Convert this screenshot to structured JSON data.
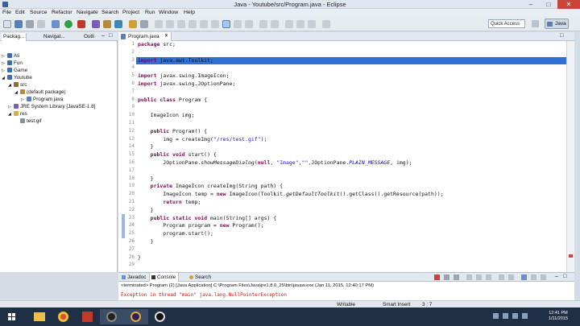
{
  "window": {
    "title": "Java - Youtube/src/Program.java - Eclipse"
  },
  "menu": [
    "File",
    "Edit",
    "Source",
    "Refactor",
    "Navigate",
    "Search",
    "Project",
    "Run",
    "Window",
    "Help"
  ],
  "toolbar": {
    "quick_access": "Quick Access",
    "perspective": "Java"
  },
  "left_panel": {
    "tabs": [
      "Packag...",
      "Navigat...",
      "Outli"
    ],
    "tree": [
      {
        "label": "Ali",
        "indent": 0,
        "arrow": "▷",
        "icon": "project"
      },
      {
        "label": "Fun",
        "indent": 0,
        "arrow": "▷",
        "icon": "project"
      },
      {
        "label": "Game",
        "indent": 0,
        "arrow": "▷",
        "icon": "project"
      },
      {
        "label": "Youtube",
        "indent": 0,
        "arrow": "◢",
        "icon": "project"
      },
      {
        "label": "src",
        "indent": 1,
        "arrow": "◢",
        "icon": "srcfolder"
      },
      {
        "label": "(default package)",
        "indent": 2,
        "arrow": "◢",
        "icon": "package"
      },
      {
        "label": "Program.java",
        "indent": 3,
        "arrow": "▷",
        "icon": "java"
      },
      {
        "label": "JRE System Library [JavaSE-1.8]",
        "indent": 1,
        "arrow": "▷",
        "icon": "library"
      },
      {
        "label": "res",
        "indent": 1,
        "arrow": "◢",
        "icon": "folder"
      },
      {
        "label": "test.gif",
        "indent": 2,
        "arrow": "",
        "icon": "file"
      }
    ]
  },
  "editor": {
    "tab": "Program.java",
    "lines": [
      {
        "n": "1",
        "html": "<span class='kw'>package</span> src;"
      },
      {
        "n": "2",
        "html": ""
      },
      {
        "n": "3",
        "html": "<span class='kw'>import</span> java.awt.Toolkit;"
      },
      {
        "n": "4",
        "html": ""
      },
      {
        "n": "5",
        "html": "<span class='kw'>import</span> javax.swing.ImageIcon;"
      },
      {
        "n": "6",
        "html": "<span class='kw'>import</span> javax.swing.JOptionPane;"
      },
      {
        "n": "7",
        "html": ""
      },
      {
        "n": "8",
        "html": "<span class='kw'>public class</span> Program {"
      },
      {
        "n": "9",
        "html": ""
      },
      {
        "n": "10",
        "html": "    ImageIcon img;"
      },
      {
        "n": "11",
        "html": ""
      },
      {
        "n": "12",
        "html": "    <span class='kw'>public</span> Program() {"
      },
      {
        "n": "13",
        "html": "        img = createImg(<span class='str'>\"/res/test.gif\"</span>);"
      },
      {
        "n": "14",
        "html": "    }"
      },
      {
        "n": "15",
        "html": "    <span class='kw'>public void</span> start() {"
      },
      {
        "n": "16",
        "html": "        JOptionPane.<span class='it'>showMessageDialog</span>(<span class='kw'>null</span>, <span class='str'>\"Image\"</span>,<span class='str'>\"\"</span>,JOptionPane.<span class='itb'>PLAIN_MESSAGE</span>, img);"
      },
      {
        "n": "17",
        "html": ""
      },
      {
        "n": "18",
        "html": "    }"
      },
      {
        "n": "19",
        "html": "    <span class='kw'>private</span> ImageIcon createImg(String path) {"
      },
      {
        "n": "20",
        "html": "        ImageIcon temp = <span class='kw'>new</span> ImageIcon(Toolkit.<span class='it'>getDefaultToolkit</span>().getClass().getResource(path));"
      },
      {
        "n": "21",
        "html": "        <span class='kw'>return</span> temp;"
      },
      {
        "n": "22",
        "html": "    }"
      },
      {
        "n": "23",
        "html": "    <span class='kw'>public static void</span> main(String[] args) {"
      },
      {
        "n": "24",
        "html": "        Program program = <span class='kw'>new</span> Program();"
      },
      {
        "n": "25",
        "html": "        program.start();"
      },
      {
        "n": "26",
        "html": "    }"
      },
      {
        "n": "27",
        "html": ""
      },
      {
        "n": "28",
        "html": "}"
      },
      {
        "n": "29",
        "html": ""
      }
    ]
  },
  "bottom_panel": {
    "tabs": [
      "Javadoc",
      "Console",
      "Search"
    ],
    "console_header": "<terminated> Program (2) [Java Application] C:\\Program Files\\Java\\jre1.8.0_25\\bin\\javaw.exe (Jan 11, 2015, 12:40:17 PM)",
    "console_error": "Exception in thread \"main\" java.lang.NullPointerException"
  },
  "status": {
    "writable": "Writable",
    "insert_mode": "Smart Insert",
    "position": "3 : 7"
  },
  "taskbar": {
    "time": "12:41 PM",
    "date": "1/11/2015"
  },
  "colors": {
    "keyword": "#7f0055",
    "string": "#2a00ff",
    "error": "#d01010",
    "selection": "#2f6fd6"
  }
}
